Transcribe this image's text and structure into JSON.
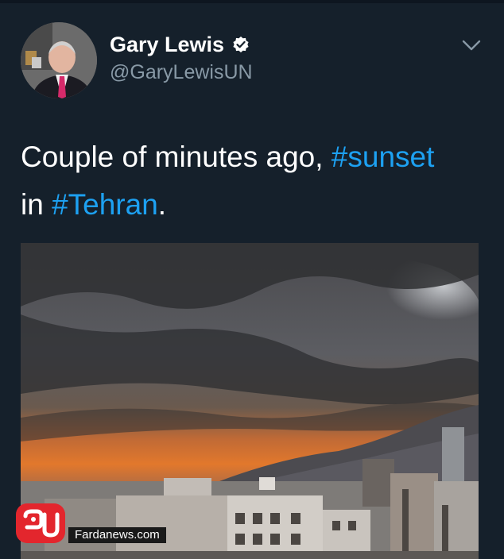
{
  "tweet": {
    "author_name": "Gary Lewis",
    "author_handle": "@GaryLewisUN",
    "text_part1": "Couple of minutes ago, ",
    "hashtag1": "#sunset",
    "text_part2": "in ",
    "hashtag2": "#Tehran",
    "text_part3": ".",
    "verified": true
  },
  "media": {
    "description_icon": "photo-sunset-tehran"
  },
  "watermark": {
    "site": "Fardanews.com"
  },
  "colors": {
    "background": "#15202b",
    "hashtag": "#1da1f2",
    "handle": "#8899a6",
    "watermark_red": "#e3262d"
  }
}
